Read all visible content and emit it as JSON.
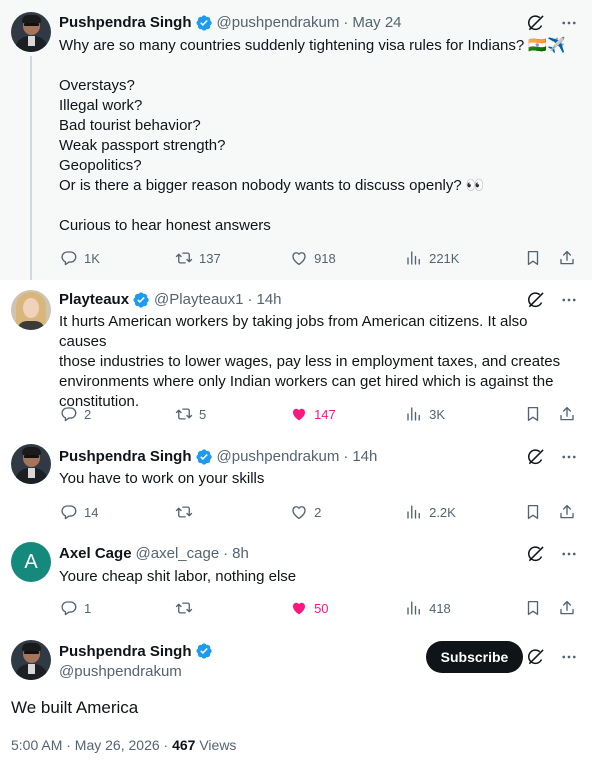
{
  "colors": {
    "verified": "#1d9bf0",
    "liked": "#f91880",
    "muted": "#536471",
    "text": "#0f1419"
  },
  "tweets": [
    {
      "author": "Pushpendra Singh",
      "handle": "@pushpendrakum",
      "sep": "·",
      "time": "May 24",
      "lines": [
        "Why are so many countries suddenly tightening visa rules for Indians? 🇮🇳✈️",
        "",
        "Overstays?",
        "Illegal work?",
        "Bad tourist behavior?",
        "Weak passport strength?",
        "Geopolitics?",
        "Or is there a bigger reason nobody wants to discuss openly? 👀",
        "",
        "Curious to hear honest answers"
      ],
      "replies": "1K",
      "reposts": "137",
      "likes": "918",
      "views": "221K"
    },
    {
      "author": "Playteaux",
      "handle": "@Playteaux1",
      "sep": "·",
      "time": "14h",
      "lines": [
        "It hurts American workers by taking jobs from American citizens. It also causes",
        "those industries to lower wages, pay less in employment taxes, and creates",
        "environments where only Indian workers can get hired which is against the",
        "constitution."
      ],
      "replies": "2",
      "reposts": "5",
      "likes": "147",
      "views": "3K"
    },
    {
      "author": "Pushpendra Singh",
      "handle": "@pushpendrakum",
      "sep": "·",
      "time": "14h",
      "lines": [
        "You have to work on your skills"
      ],
      "replies": "14",
      "reposts": "",
      "likes": "2",
      "views": "2.2K"
    },
    {
      "author": "Axel Cage",
      "avatar_letter": "A",
      "handle": "@axel_cage",
      "sep": "·",
      "time": "8h",
      "lines": [
        "Youre cheap shit labor, nothing else"
      ],
      "replies": "1",
      "reposts": "",
      "likes": "50",
      "views": "418"
    }
  ],
  "main": {
    "author": "Pushpendra Singh",
    "handle": "@pushpendrakum",
    "subscribe_label": "Subscribe",
    "text": "We built America",
    "timestamp": "5:00 AM · May 26, 2026 · ",
    "views_count": "467",
    "views_label": " Views"
  }
}
